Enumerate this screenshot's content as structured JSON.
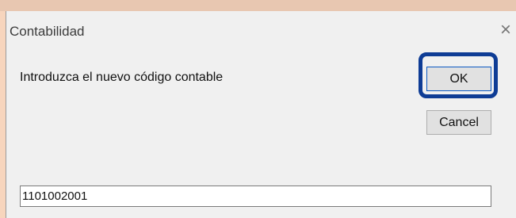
{
  "dialog": {
    "title": "Contabilidad",
    "prompt": "Introduzca el nuevo código contable",
    "ok_label": "OK",
    "cancel_label": "Cancel",
    "input_value": "1101002001",
    "close_icon": "×"
  }
}
